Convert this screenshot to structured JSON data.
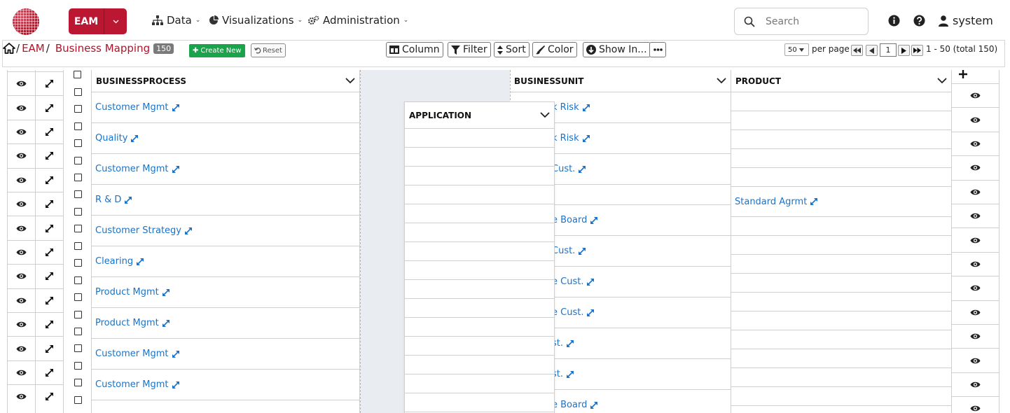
{
  "app": {
    "eam_label": "EAM",
    "menus": [
      "Data",
      "Visualizations",
      "Administration"
    ],
    "search_placeholder": "Search",
    "user": "system"
  },
  "breadcrumb": {
    "home_sep": "/",
    "eam": "EAM",
    "sep": "/",
    "page": "Business Mapping",
    "count": "150"
  },
  "toolbar": {
    "create_new": "Create New",
    "reset": "Reset",
    "column": "Column",
    "filter": "Filter",
    "sort": "Sort",
    "color": "Color",
    "show_in": "Show In..."
  },
  "pager": {
    "page_size": "50",
    "per_page": "per page",
    "current_page": "1",
    "range": "1 - 50 (total 150)"
  },
  "columns": {
    "businessprocess": "BUSINESSPROCESS",
    "businessunit": "BUSINESSUNIT",
    "product": "PRODUCT",
    "application": "APPLICATION"
  },
  "businessprocess_rows": [
    "Customer Mgmt",
    "Quality",
    "Customer Mgmt",
    "R & D",
    "Customer Strategy",
    "Clearing",
    "Product Mgmt",
    "Product Mgmt",
    "Customer Mgmt",
    "Customer Mgmt"
  ],
  "businessunit_rows": [
    "k Risk",
    "k Risk",
    "Cust.",
    "",
    "e Board",
    "Cust.",
    "e Cust.",
    "e Cust.",
    "st.",
    "st.",
    "e Board"
  ],
  "product_rows": [
    "",
    "",
    "",
    "",
    "",
    "Standard Agrmt",
    "",
    "",
    "",
    "",
    "",
    "",
    "",
    ""
  ]
}
